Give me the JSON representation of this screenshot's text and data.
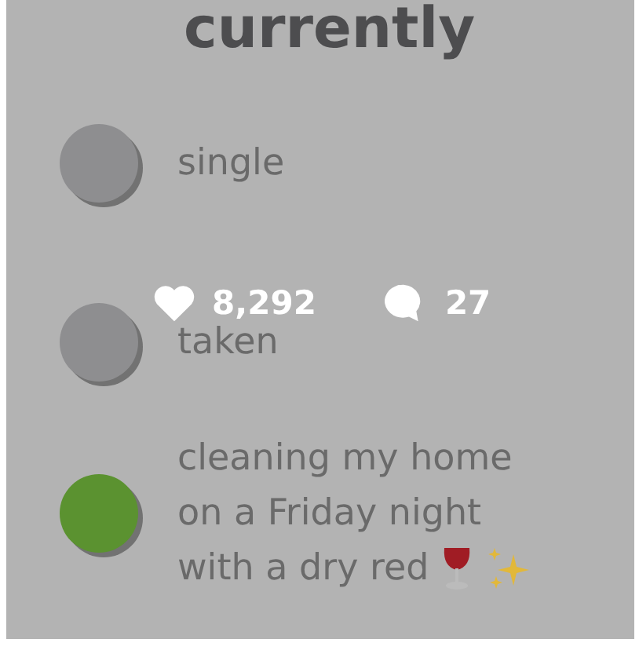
{
  "title": "currently",
  "options": [
    {
      "label": "single",
      "color": "#8e8e90"
    },
    {
      "label": "taken",
      "color": "#8e8e90"
    },
    {
      "label": "cleaning my home on a Friday night with a dry red",
      "color": "#5b9230"
    }
  ],
  "stats": {
    "likes": "8,292",
    "comments": "27"
  }
}
